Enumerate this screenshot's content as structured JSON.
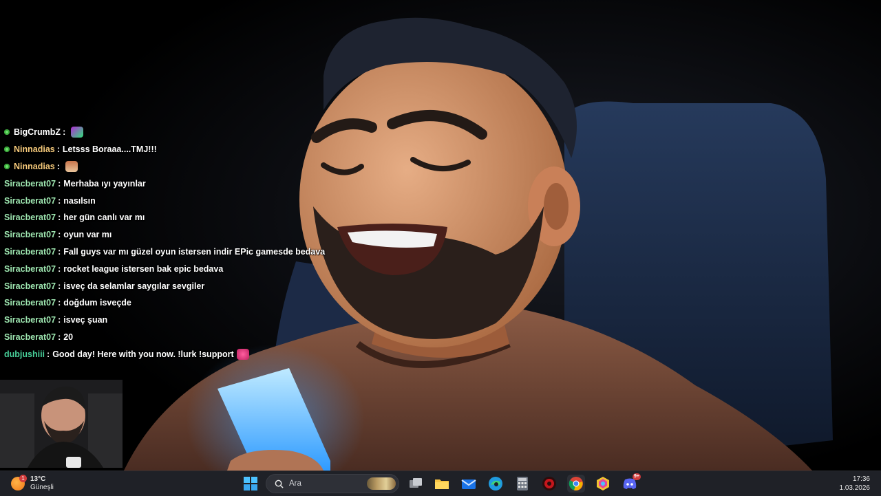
{
  "chat": {
    "messages": [
      {
        "user": "BigCrumbZ",
        "sep": ":",
        "text": "",
        "user_color": "#ffffff",
        "badge": true,
        "emote": "go-emote"
      },
      {
        "user": "Ninnadias",
        "sep": ":",
        "text": "Letsss Boraaa....TMJ!!!",
        "user_color": "#f5c97a",
        "badge": true,
        "emote": ""
      },
      {
        "user": "Ninnadias",
        "sep": ":",
        "text": "",
        "user_color": "#f5c97a",
        "badge": true,
        "emote": "character-emote"
      },
      {
        "user": "Siracberat07",
        "sep": ":",
        "text": "Merhaba ıyı yayınlar",
        "user_color": "#9ee6b0",
        "badge": false,
        "emote": ""
      },
      {
        "user": "Siracberat07",
        "sep": ":",
        "text": "nasılsın",
        "user_color": "#9ee6b0",
        "badge": false,
        "emote": ""
      },
      {
        "user": "Siracberat07",
        "sep": ":",
        "text": "her gün canlı var mı",
        "user_color": "#9ee6b0",
        "badge": false,
        "emote": ""
      },
      {
        "user": "Siracberat07",
        "sep": ":",
        "text": "oyun var mı",
        "user_color": "#9ee6b0",
        "badge": false,
        "emote": ""
      },
      {
        "user": "Siracberat07",
        "sep": ":",
        "text": "Fall guys var mı güzel oyun istersen indir EPic gamesde bedava",
        "user_color": "#9ee6b0",
        "badge": false,
        "emote": ""
      },
      {
        "user": "Siracberat07",
        "sep": ":",
        "text": "rocket league istersen bak epic bedava",
        "user_color": "#9ee6b0",
        "badge": false,
        "emote": ""
      },
      {
        "user": "Siracberat07",
        "sep": ":",
        "text": "isveç da selamlar saygılar sevgiler",
        "user_color": "#9ee6b0",
        "badge": false,
        "emote": ""
      },
      {
        "user": "Siracberat07",
        "sep": ":",
        "text": "doğdum isveçde",
        "user_color": "#9ee6b0",
        "badge": false,
        "emote": ""
      },
      {
        "user": "Siracberat07",
        "sep": ":",
        "text": "isveç şuan",
        "user_color": "#9ee6b0",
        "badge": false,
        "emote": ""
      },
      {
        "user": "Siracberat07",
        "sep": ":",
        "text": "20",
        "user_color": "#9ee6b0",
        "badge": false,
        "emote": ""
      },
      {
        "user": "dubjushiii",
        "sep": ":",
        "text": "Good day! Here with you now. !lurk !support",
        "user_color": "#48d09a",
        "badge": false,
        "emote": "heart-emote"
      }
    ]
  },
  "taskbar": {
    "weather": {
      "temp": "13°C",
      "condition": "Güneşli",
      "notification_count": "1",
      "icon": "sun-icon"
    },
    "search": {
      "placeholder": "Ara"
    },
    "discord_badge": "9+",
    "clock": {
      "time": "17:36",
      "date": "1.03.2026"
    },
    "pinned": [
      "start-icon",
      "task-view-icon",
      "file-explorer-icon",
      "mail-icon",
      "edge-icon",
      "calculator-icon",
      "red-app-icon",
      "chrome-icon",
      "colorful-app-icon",
      "discord-icon"
    ]
  },
  "colors": {
    "taskbar_bg": "#1f2127",
    "badge_green": "#6ee06e",
    "background": "#000000"
  }
}
